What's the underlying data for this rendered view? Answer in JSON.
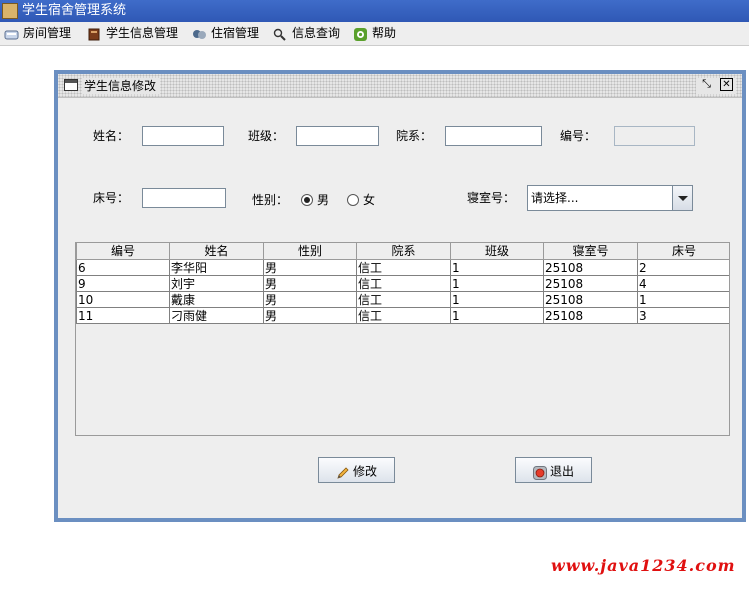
{
  "app": {
    "title": "学生宿舍管理系统",
    "icon": "java-cup-icon"
  },
  "menubar": {
    "items": [
      {
        "label": "房间管理",
        "icon": "room-icon"
      },
      {
        "label": "学生信息管理",
        "icon": "student-book-icon"
      },
      {
        "label": "住宿管理",
        "icon": "lodging-icon"
      },
      {
        "label": "信息查询",
        "icon": "magnifier-icon"
      },
      {
        "label": "帮助",
        "icon": "help-icon"
      }
    ]
  },
  "dialog": {
    "title": "学生信息修改",
    "form": {
      "name_label": "姓名：",
      "class_label": "班级：",
      "dept_label": "院系：",
      "id_label": "编号：",
      "bed_label": "床号：",
      "gender_label": "性别：",
      "gender_male": "男",
      "gender_female": "女",
      "gender_selected": "男",
      "room_label": "寝室号：",
      "room_value": "请选择...",
      "name_value": "",
      "class_value": "",
      "dept_value": "",
      "id_value": "",
      "bed_value": ""
    },
    "table": {
      "columns": [
        "编号",
        "姓名",
        "性别",
        "院系",
        "班级",
        "寝室号",
        "床号"
      ],
      "rows": [
        [
          "6",
          "李华阳",
          "男",
          "信工",
          "1",
          "25108",
          "2"
        ],
        [
          "9",
          "刘宇",
          "男",
          "信工",
          "1",
          "25108",
          "4"
        ],
        [
          "10",
          "戴康",
          "男",
          "信工",
          "1",
          "25108",
          "1"
        ],
        [
          "11",
          "刁雨健",
          "男",
          "信工",
          "1",
          "25108",
          "3"
        ]
      ]
    },
    "buttons": {
      "modify": "修改",
      "exit": "退出"
    }
  },
  "watermark": "www.java1234.com",
  "colors": {
    "titlebar": "#3361c2",
    "frame_border": "#6b8fc1",
    "watermark": "#e01010"
  }
}
